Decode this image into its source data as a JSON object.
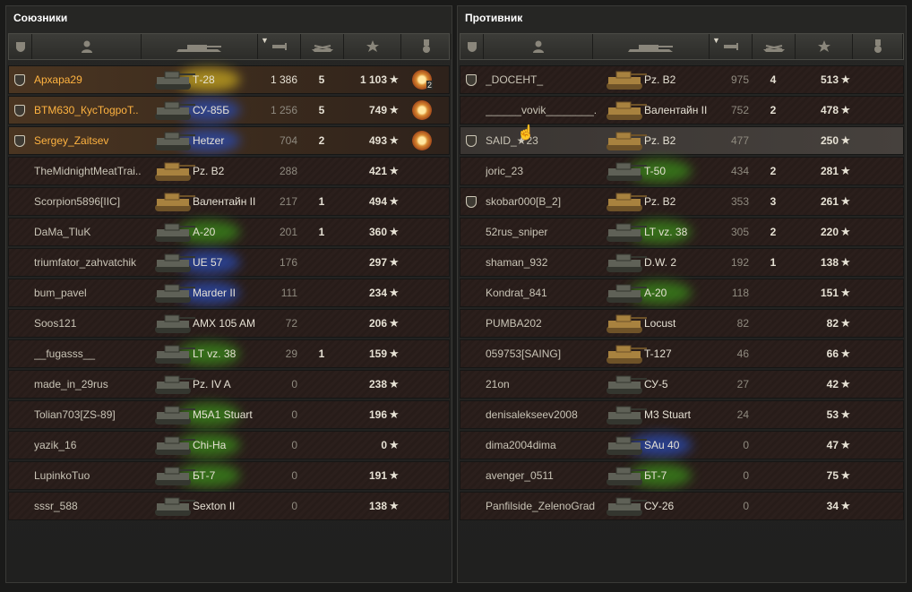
{
  "allies": {
    "title": "Союзники",
    "rows": [
      {
        "name": "Архара29",
        "vehicle": "Т-28",
        "damage": "1 386",
        "kills": "5",
        "xp": "1 103",
        "badge": true,
        "medal": true,
        "medal_count": "2",
        "hl": true,
        "tank": "tank-t28",
        "glow": "#c8a820",
        "dmg_hi": true
      },
      {
        "name": "BTM630_КусТоgpoT..",
        "vehicle": "СУ-85Б",
        "damage": "1 256",
        "kills": "5",
        "xp": "749",
        "badge": true,
        "medal": true,
        "medal_count": "",
        "hl": true,
        "tank": "tank-su85b",
        "glow": "#2a4ab0",
        "dmg_hi": false
      },
      {
        "name": "Sergey_Zaitsev",
        "vehicle": "Hetzer",
        "damage": "704",
        "kills": "2",
        "xp": "493",
        "badge": true,
        "medal": true,
        "medal_count": "",
        "hl": true,
        "tank": "tank-hetzer",
        "glow": "#2a4ab0",
        "dmg_hi": false
      },
      {
        "name": "TheMidnightMeatTrai..",
        "vehicle": "Pz. B2",
        "damage": "288",
        "kills": "",
        "xp": "421",
        "badge": false,
        "medal": false,
        "medal_count": "",
        "hl": false,
        "tank": "tank-pzb2",
        "glow": "",
        "dmg_hi": false
      },
      {
        "name": "Scorpion5896[IIC]",
        "vehicle": "Валентайн II",
        "damage": "217",
        "kills": "1",
        "xp": "494",
        "badge": false,
        "medal": false,
        "medal_count": "",
        "hl": false,
        "tank": "tank-valentine",
        "glow": "",
        "dmg_hi": false
      },
      {
        "name": "DaMa_TluK",
        "vehicle": "A-20",
        "damage": "201",
        "kills": "1",
        "xp": "360",
        "badge": false,
        "medal": false,
        "medal_count": "",
        "hl": false,
        "tank": "tank-a20",
        "glow": "#3a8a1a",
        "dmg_hi": false
      },
      {
        "name": "triumfator_zahvatchik",
        "vehicle": "UE 57",
        "damage": "176",
        "kills": "",
        "xp": "297",
        "badge": false,
        "medal": false,
        "medal_count": "",
        "hl": false,
        "tank": "tank-ue57",
        "glow": "#2a4ab0",
        "dmg_hi": false
      },
      {
        "name": "bum_pavel",
        "vehicle": "Marder II",
        "damage": "111",
        "kills": "",
        "xp": "234",
        "badge": false,
        "medal": false,
        "medal_count": "",
        "hl": false,
        "tank": "tank-marder",
        "glow": "#2a4ab0",
        "dmg_hi": false
      },
      {
        "name": "Soos121",
        "vehicle": "AMX 105 AM",
        "damage": "72",
        "kills": "",
        "xp": "206",
        "badge": false,
        "medal": false,
        "medal_count": "",
        "hl": false,
        "tank": "tank-amx105",
        "glow": "",
        "dmg_hi": false
      },
      {
        "name": "__fugasss__",
        "vehicle": "LT vz. 38",
        "damage": "29",
        "kills": "1",
        "xp": "159",
        "badge": false,
        "medal": false,
        "medal_count": "",
        "hl": false,
        "tank": "tank-ltvz38",
        "glow": "#3a8a1a",
        "dmg_hi": false
      },
      {
        "name": "made_in_29rus",
        "vehicle": "Pz. IV A",
        "damage": "0",
        "kills": "",
        "xp": "238",
        "badge": false,
        "medal": false,
        "medal_count": "",
        "hl": false,
        "tank": "tank-pz4a",
        "glow": "",
        "dmg_hi": false
      },
      {
        "name": "Tolian703[ZS-89]",
        "vehicle": "M5A1 Stuart",
        "damage": "0",
        "kills": "",
        "xp": "196",
        "badge": false,
        "medal": false,
        "medal_count": "",
        "hl": false,
        "tank": "tank-m5a1",
        "glow": "#3a8a1a",
        "dmg_hi": false
      },
      {
        "name": "yazik_16",
        "vehicle": "Chi-Ha",
        "damage": "0",
        "kills": "",
        "xp": "0",
        "badge": false,
        "medal": false,
        "medal_count": "",
        "hl": false,
        "tank": "tank-chiha",
        "glow": "#3a8a1a",
        "dmg_hi": false
      },
      {
        "name": "LupinkoTuo",
        "vehicle": "БТ-7",
        "damage": "0",
        "kills": "",
        "xp": "191",
        "badge": false,
        "medal": false,
        "medal_count": "",
        "hl": false,
        "tank": "tank-bt7",
        "glow": "#3a8a1a",
        "dmg_hi": false
      },
      {
        "name": "sssr_588",
        "vehicle": "Sexton II",
        "damage": "0",
        "kills": "",
        "xp": "138",
        "badge": false,
        "medal": false,
        "medal_count": "",
        "hl": false,
        "tank": "tank-sexton",
        "glow": "",
        "dmg_hi": false
      }
    ]
  },
  "enemies": {
    "title": "Противник",
    "rows": [
      {
        "name": "_DOCEHT_",
        "vehicle": "Pz. B2",
        "damage": "975",
        "kills": "4",
        "xp": "513",
        "badge": true,
        "medal": false,
        "medal_count": "",
        "hl": false,
        "tank": "tank-pzb2",
        "glow": "",
        "dmg_hi": false
      },
      {
        "name": "______vovik________..",
        "vehicle": "Валентайн II",
        "damage": "752",
        "kills": "2",
        "xp": "478",
        "badge": false,
        "medal": false,
        "medal_count": "",
        "hl": false,
        "tank": "tank-valentine",
        "glow": "",
        "dmg_hi": false
      },
      {
        "name": "SAID_★23",
        "vehicle": "Pz. B2",
        "damage": "477",
        "kills": "",
        "xp": "250",
        "badge": true,
        "medal": false,
        "medal_count": "",
        "hl": false,
        "hover": true,
        "tank": "tank-pzb2",
        "glow": "",
        "dmg_hi": false
      },
      {
        "name": "joric_23",
        "vehicle": "T-50",
        "damage": "434",
        "kills": "2",
        "xp": "281",
        "badge": false,
        "medal": false,
        "medal_count": "",
        "hl": false,
        "tank": "tank-t50",
        "glow": "#3a8a1a",
        "dmg_hi": false
      },
      {
        "name": "skobar000[B_2]",
        "vehicle": "Pz. B2",
        "damage": "353",
        "kills": "3",
        "xp": "261",
        "badge": true,
        "medal": false,
        "medal_count": "",
        "hl": false,
        "tank": "tank-pzb2",
        "glow": "",
        "dmg_hi": false
      },
      {
        "name": "52rus_sniper",
        "vehicle": "LT vz. 38",
        "damage": "305",
        "kills": "2",
        "xp": "220",
        "badge": false,
        "medal": false,
        "medal_count": "",
        "hl": false,
        "tank": "tank-ltvz38",
        "glow": "#3a8a1a",
        "dmg_hi": false
      },
      {
        "name": "shaman_932",
        "vehicle": "D.W. 2",
        "damage": "192",
        "kills": "1",
        "xp": "138",
        "badge": false,
        "medal": false,
        "medal_count": "",
        "hl": false,
        "tank": "tank-dw2",
        "glow": "",
        "dmg_hi": false
      },
      {
        "name": "Kondrat_841",
        "vehicle": "A-20",
        "damage": "118",
        "kills": "",
        "xp": "151",
        "badge": false,
        "medal": false,
        "medal_count": "",
        "hl": false,
        "tank": "tank-a20",
        "glow": "#3a8a1a",
        "dmg_hi": false
      },
      {
        "name": "PUMBA202",
        "vehicle": "Locust",
        "damage": "82",
        "kills": "",
        "xp": "82",
        "badge": false,
        "medal": false,
        "medal_count": "",
        "hl": false,
        "tank": "tank-locust",
        "glow": "",
        "dmg_hi": false
      },
      {
        "name": "059753[SAING]",
        "vehicle": "T-127",
        "damage": "46",
        "kills": "",
        "xp": "66",
        "badge": false,
        "medal": false,
        "medal_count": "",
        "hl": false,
        "tank": "tank-t127",
        "glow": "",
        "dmg_hi": false
      },
      {
        "name": "21on",
        "vehicle": "СУ-5",
        "damage": "27",
        "kills": "",
        "xp": "42",
        "badge": false,
        "medal": false,
        "medal_count": "",
        "hl": false,
        "tank": "tank-su5",
        "glow": "",
        "dmg_hi": false
      },
      {
        "name": "denisalekseev2008",
        "vehicle": "M3 Stuart",
        "damage": "24",
        "kills": "",
        "xp": "53",
        "badge": false,
        "medal": false,
        "medal_count": "",
        "hl": false,
        "tank": "tank-m3",
        "glow": "",
        "dmg_hi": false
      },
      {
        "name": "dima2004dima",
        "vehicle": "SAu 40",
        "damage": "0",
        "kills": "",
        "xp": "47",
        "badge": false,
        "medal": false,
        "medal_count": "",
        "hl": false,
        "tank": "tank-sau40",
        "glow": "#2a4ab0",
        "dmg_hi": false
      },
      {
        "name": "avenger_0511",
        "vehicle": "БТ-7",
        "damage": "0",
        "kills": "",
        "xp": "75",
        "badge": false,
        "medal": false,
        "medal_count": "",
        "hl": false,
        "tank": "tank-bt7",
        "glow": "#3a8a1a",
        "dmg_hi": false
      },
      {
        "name": "Panfilside_ZelenoGrad",
        "vehicle": "СУ-26",
        "damage": "0",
        "kills": "",
        "xp": "34",
        "badge": false,
        "medal": false,
        "medal_count": "",
        "hl": false,
        "tank": "tank-su26",
        "glow": "",
        "dmg_hi": false
      }
    ]
  },
  "star_glyph": "★",
  "tank_colors": {
    "gray": "#5f6157",
    "tan": "#a07a3f"
  }
}
